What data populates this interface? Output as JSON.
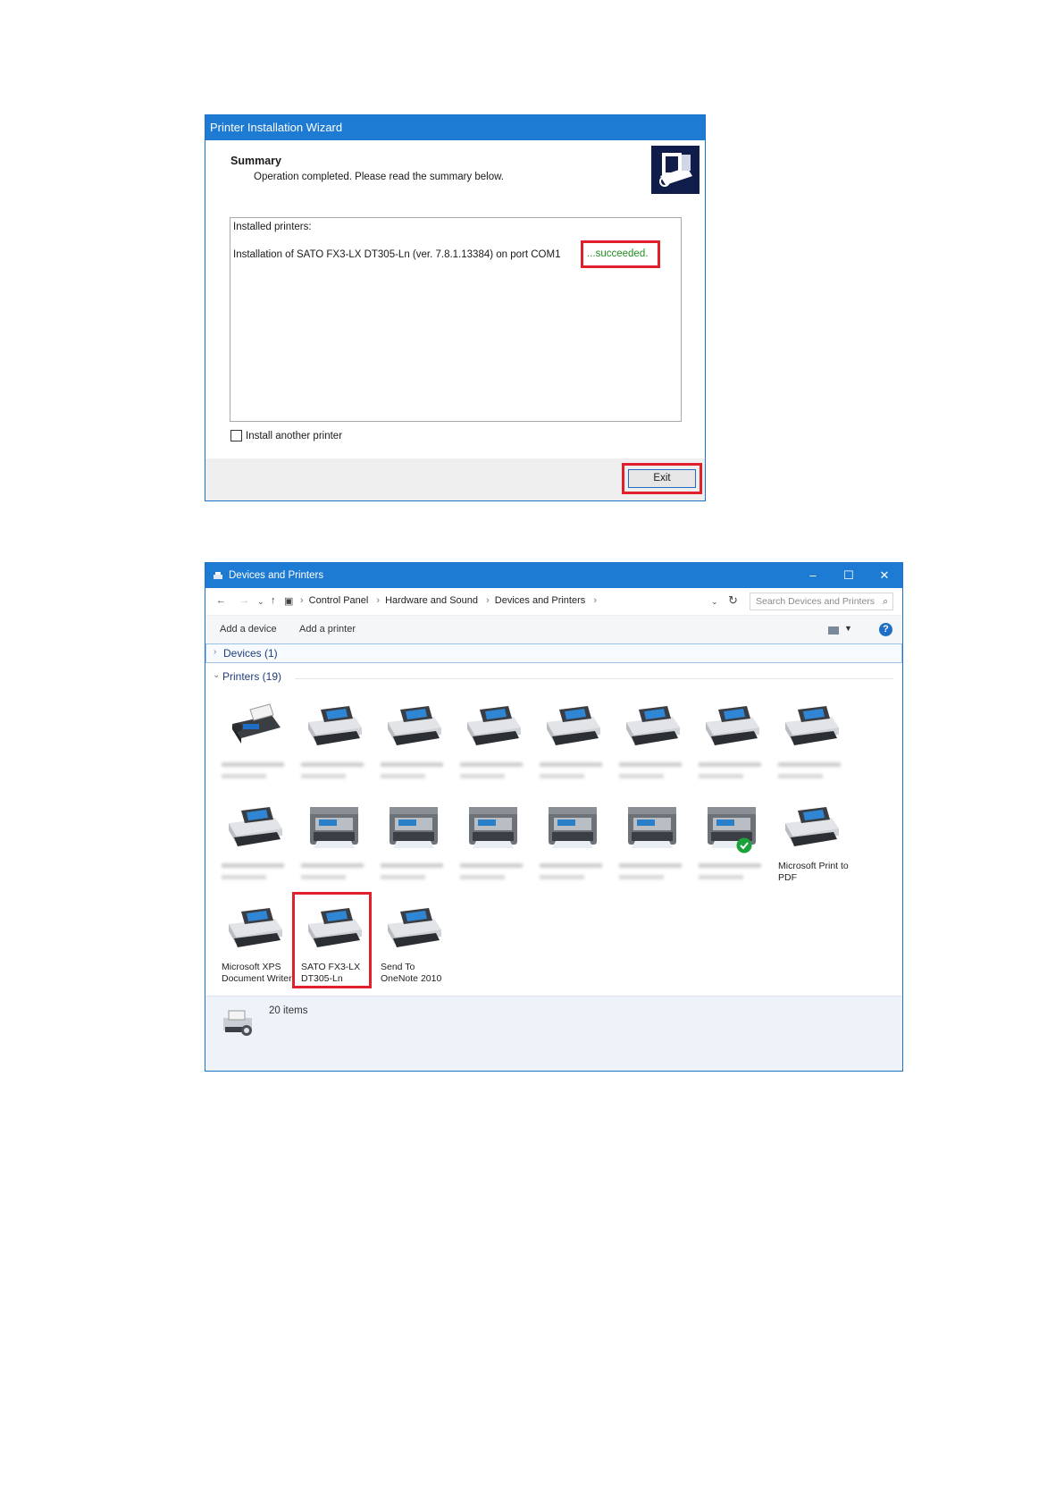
{
  "wizard": {
    "title": "Printer Installation Wizard",
    "summary_heading": "Summary",
    "summary_sub": "Operation completed. Please read the summary below.",
    "installed_label": "Installed printers:",
    "install_line": "Installation of SATO FX3-LX DT305-Ln (ver. 7.8.1.13384) on port COM1",
    "status": "...succeeded.",
    "checkbox_label": "Install another printer",
    "exit_label": "Exit",
    "colors": {
      "titlebar": "#1e7bd4",
      "highlight": "#e0202a",
      "success": "#1f8f1f"
    }
  },
  "explorer": {
    "title": "Devices and Printers",
    "window_buttons": [
      "–",
      "☐",
      "✕"
    ],
    "breadcrumb": [
      "Control Panel",
      "Hardware and Sound",
      "Devices and Printers"
    ],
    "search_placeholder": "Search Devices and Printers",
    "commands": {
      "add_device": "Add a device",
      "add_printer": "Add a printer"
    },
    "groups": {
      "devices": "Devices (1)",
      "printers": "Printers (19)"
    },
    "printers": [
      {
        "label": "",
        "icon": "fax-icon"
      },
      {
        "label": "",
        "icon": "printer-icon"
      },
      {
        "label": "",
        "icon": "printer-icon"
      },
      {
        "label": "",
        "icon": "printer-icon"
      },
      {
        "label": "",
        "icon": "printer-icon"
      },
      {
        "label": "",
        "icon": "printer-icon"
      },
      {
        "label": "",
        "icon": "printer-icon"
      },
      {
        "label": "",
        "icon": "printer-icon"
      },
      {
        "label": "",
        "icon": "printer-icon"
      },
      {
        "label": "",
        "icon": "mfp-icon"
      },
      {
        "label": "",
        "icon": "mfp-icon"
      },
      {
        "label": "",
        "icon": "mfp-icon"
      },
      {
        "label": "",
        "icon": "mfp-icon"
      },
      {
        "label": "",
        "icon": "mfp-icon"
      },
      {
        "label": "",
        "icon": "mfp-icon",
        "default": true
      },
      {
        "label": "Microsoft Print to PDF",
        "icon": "printer-icon"
      },
      {
        "label": "Microsoft XPS Document Writer",
        "icon": "printer-icon"
      },
      {
        "label": "SATO FX3-LX DT305-Ln",
        "icon": "printer-icon",
        "highlighted": true
      },
      {
        "label": "Send To OneNote 2010",
        "icon": "printer-icon"
      }
    ],
    "status_count": "20 items"
  }
}
